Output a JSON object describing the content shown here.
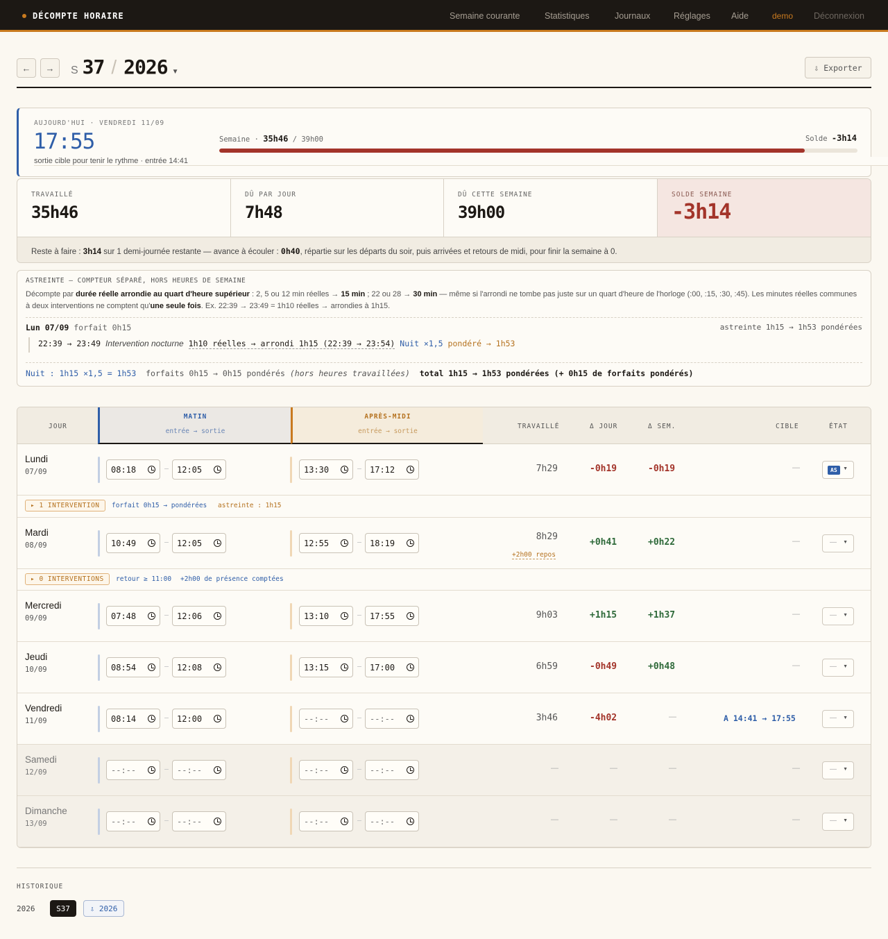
{
  "app": {
    "brand": "DÉCOMPTE HORAIRE"
  },
  "nav": {
    "semaine": "Semaine courante",
    "stats": "Statistiques",
    "journaux": "Journaux",
    "reglages": "Réglages",
    "aide": "Aide",
    "user": "demo",
    "logout": "Déconnexion"
  },
  "week": {
    "prev": "←",
    "next": "→",
    "s": "S",
    "number": "37",
    "year": "2026",
    "export": "⇩ Exporter"
  },
  "today": {
    "label": "AUJOURD'HUI · VENDREDI 11/09",
    "time": "17:55",
    "sub": "sortie cible pour tenir le rythme · entrée 14:41",
    "semaine_label": "Semaine ·",
    "semaine_val": "35h46",
    "semaine_due": "/ 39h00",
    "solde_label": "Solde",
    "solde_val": "-3h14",
    "progress_fraction": 0.917
  },
  "stats": [
    {
      "key": "TRAVAILLÉ",
      "value": "35h46"
    },
    {
      "key": "DÛ PAR JOUR",
      "value": "7h48"
    },
    {
      "key": "DÛ CETTE SEMAINE",
      "value": "39h00"
    },
    {
      "key": "SOLDE SEMAINE",
      "value": "-3h14"
    }
  ],
  "reste": {
    "p1": "Reste à faire : ",
    "b1": "3h14",
    "p2": " sur 1 demi-journée restante — avance à écouler : ",
    "b2": "0h40",
    "p3": ", répartie sur les départs du soir, puis arrivées et retours de midi, pour finir la semaine à 0."
  },
  "astreinte": {
    "header": "ASTREINTE — COMPTEUR SÉPARÉ, HORS HEURES DE SEMAINE",
    "d1": "Décompte par ",
    "d1b": "durée réelle arrondie au quart d'heure supérieur",
    "d2": " : 2, 5 ou 12 min réelles → ",
    "d2b": "15 min",
    "d3": " ; 22 ou 28 → ",
    "d3b": "30 min",
    "d4": " — même si l'arrondi ne tombe pas juste sur un quart d'heure de l'horloge (:00, :15, :30, :45). Les minutes réelles communes à deux interventions ne comptent qu'",
    "d4b": "une seule fois",
    "d5": ". Ex. 22:39 → 23:49 = 1h10 réelles → arrondies à 1h15.",
    "day": "Lun 07/09",
    "forfait": "forfait 0h15",
    "day_right": "astreinte 1h15 → 1h53 pondérées",
    "iv_time": "22:39 → 23:49",
    "iv_label": "Intervention nocturne",
    "iv_calc": "1h10 réelles → arrondi 1h15 (22:39 → 23:54)",
    "iv_nuit": "Nuit ×1,5",
    "iv_pond": "pondéré → 1h53",
    "foot_nuit": "Nuit : 1h15 ×1,5 = 1h53",
    "foot_forf": "forfaits 0h15 → 0h15 pondérés",
    "foot_hors": "(hors heures travaillées)",
    "foot_total": "total 1h15 → 1h53 pondérées (+ 0h15 de forfaits pondérés)"
  },
  "table": {
    "headers": {
      "jour": "JOUR",
      "matin": "MATIN",
      "apm": "APRÈS-MIDI",
      "es": "entrée → sortie",
      "travaille": "TRAVAILLÉ",
      "djour": "Δ JOUR",
      "dsem": "Δ SEM.",
      "cible": "CIBLE",
      "etat": "ÉTAT"
    },
    "empty_time": "--:--",
    "dash": "—",
    "rows": [
      {
        "name": "Lundi",
        "date": "07/09",
        "m_in": "08:18",
        "m_out": "12:05",
        "a_in": "13:30",
        "a_out": "17:12",
        "worked": "7h29",
        "dj": "-0h19",
        "ds": "-0h19",
        "etat": "AS"
      },
      {
        "name": "Mardi",
        "date": "08/09",
        "m_in": "10:49",
        "m_out": "12:05",
        "a_in": "12:55",
        "a_out": "18:19",
        "worked": "8h29",
        "repos": "+2h00 repos",
        "dj": "+0h41",
        "ds": "+0h22"
      },
      {
        "name": "Mercredi",
        "date": "09/09",
        "m_in": "07:48",
        "m_out": "12:06",
        "a_in": "13:10",
        "a_out": "17:55",
        "worked": "9h03",
        "dj": "+1h15",
        "ds": "+1h37"
      },
      {
        "name": "Jeudi",
        "date": "10/09",
        "m_in": "08:54",
        "m_out": "12:08",
        "a_in": "13:15",
        "a_out": "17:00",
        "worked": "6h59",
        "dj": "-0h49",
        "ds": "+0h48"
      },
      {
        "name": "Vendredi",
        "date": "11/09",
        "m_in": "08:14",
        "m_out": "12:00",
        "worked": "3h46",
        "dj": "-4h02",
        "cible": "A 14:41 → 17:55"
      },
      {
        "name": "Samedi",
        "date": "12/09"
      },
      {
        "name": "Dimanche",
        "date": "13/09"
      }
    ],
    "sub1": {
      "tag": "▸ 1 INTERVENTION",
      "a": "forfait 0h15 → pondérées",
      "b": "astreinte : 1h15"
    },
    "sub2": {
      "tag": "▸ 0 INTERVENTIONS",
      "a": "retour ≥ 11:00",
      "b": "+2h00 de présence comptées"
    }
  },
  "historique": {
    "label": "HISTORIQUE",
    "year": "2026",
    "chip1": "S37",
    "chip2": "⇩ 2026"
  },
  "colors": {
    "accent": "#c97a1f",
    "blue": "#2f5ea8",
    "negative": "#a3342a",
    "positive": "#2f6a3a"
  }
}
